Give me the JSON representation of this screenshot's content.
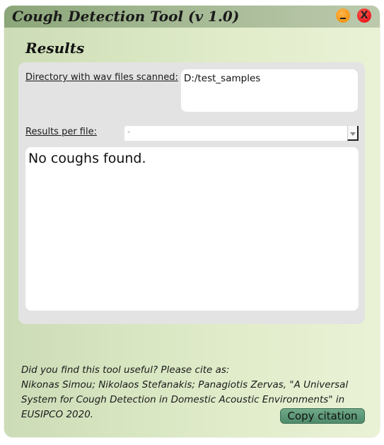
{
  "window": {
    "title": "Cough Detection Tool (v 1.0)",
    "accent_color": "#8ba679",
    "minimize_icon": "minimize-icon",
    "close_icon": "close-icon",
    "close_glyph": "X"
  },
  "results": {
    "heading": "Results",
    "directory_label": "Directory with wav files scanned:",
    "directory_value": "D:/test_samples",
    "per_file_label": "Results per file:",
    "per_file_selected": "-",
    "output_text": "No coughs found."
  },
  "citation": {
    "lines": [
      "Did you find this tool useful? Please cite as:",
      "Nikonas Simou; Nikolaos Stefanakis; Panagiotis Zervas, \"A Universal",
      "System for Cough Detection in Domestic Acoustic Environments\" in",
      "EUSIPCO 2020."
    ],
    "copy_button_label": "Copy citation",
    "button_color": "#5e9b7b"
  }
}
